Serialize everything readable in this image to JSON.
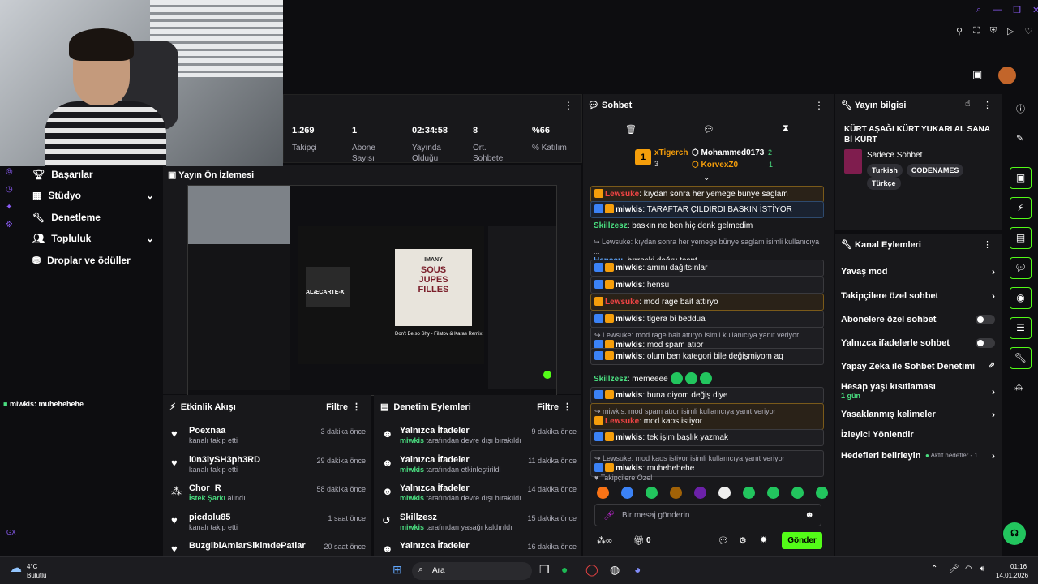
{
  "stats": [
    {
      "value": "1.269",
      "label": "Takipçi"
    },
    {
      "value": "1",
      "label": "Abone Sayısı"
    },
    {
      "value": "02:34:58",
      "label": "Yayında Olduğu"
    },
    {
      "value": "8",
      "label": "Ort. Sohbete"
    },
    {
      "value": "%66",
      "label": "% Katılım"
    }
  ],
  "nav": [
    {
      "label": "Başarılar",
      "chevron": false
    },
    {
      "label": "Stüdyo",
      "chevron": true
    },
    {
      "label": "Denetleme",
      "chevron": false
    },
    {
      "label": "Topluluk",
      "chevron": true
    },
    {
      "label": "Droplar ve ödüller",
      "chevron": false
    }
  ],
  "left_chat": {
    "user": "miwkis",
    "text": ": muhehehehe"
  },
  "preview": {
    "title": "Yayın Ön İzlemesi",
    "album_top": "IMANY",
    "album_mid": "SOUS",
    "album_mid2": "JUPES",
    "album_bot": "FILLES",
    "track": "Don't Be so Shy - Filatov & Karas Remix",
    "left_album": "ALÆCARTE-X"
  },
  "activity": {
    "title": "Etkinlik Akışı",
    "filter": "Filtre",
    "items": [
      {
        "name": "Poexnaa",
        "sub": "kanalı takip etti",
        "sub_green": "",
        "time": "3 dakika önce",
        "icon": "heart-icon"
      },
      {
        "name": "l0n3lySH3ph3RD",
        "sub": "kanalı takip etti",
        "sub_green": "",
        "time": "29 dakika önce",
        "icon": "heart-icon"
      },
      {
        "name": "Chor_R",
        "sub": "alındı",
        "sub_green": "İstek Şarkı",
        "time": "58 dakika önce",
        "icon": "points-icon"
      },
      {
        "name": "picdolu85",
        "sub": "kanalı takip etti",
        "sub_green": "",
        "time": "1 saat önce",
        "icon": "heart-icon"
      },
      {
        "name": "BuzgibiAmlarSikimdePatlar",
        "sub": "",
        "sub_green": "",
        "time": "20 saat önce",
        "icon": "heart-icon"
      }
    ]
  },
  "moderation": {
    "title": "Denetim Eylemleri",
    "filter": "Filtre",
    "items": [
      {
        "name": "Yalnızca İfadeler",
        "user": "miwkis",
        "sub": "tarafından devre dışı bırakıldı",
        "time": "9 dakika önce"
      },
      {
        "name": "Yalnızca İfadeler",
        "user": "miwkis",
        "sub": "tarafından etkinleştirildi",
        "time": "11 dakika önce"
      },
      {
        "name": "Yalnızca İfadeler",
        "user": "miwkis",
        "sub": "tarafından devre dışı bırakıldı",
        "time": "14 dakika önce"
      },
      {
        "name": "Skillzesz",
        "user": "miwkis",
        "sub": "tarafından yasağı kaldırıldı",
        "time": "15 dakika önce"
      },
      {
        "name": "Yalnızca İfadeler",
        "user": "",
        "sub": "",
        "time": "16 dakika önce"
      }
    ]
  },
  "chat": {
    "title": "Sohbet",
    "top_gifters": [
      {
        "rank": "1",
        "name": "xTigerch",
        "count": "3"
      },
      {
        "name": "Mohammed0173",
        "count": "2"
      },
      {
        "name": "KorvexZ0",
        "count": "1"
      }
    ],
    "messages": [
      {
        "reply": "",
        "user": "Lewsuke",
        "utype": "red",
        "text": ": kıydan sonra her yemege bünye saglam",
        "style": "redbox",
        "badges": 1
      },
      {
        "reply": "",
        "user": "miwkis",
        "utype": "blue",
        "text": ": TARAFTAR ÇILDIRDI BASKIN İSTİYOR",
        "style": "bluebox",
        "badges": 2
      },
      {
        "reply": "",
        "user": "Skillzesz",
        "utype": "green",
        "text": ": baskın ne ben hiç denk gelmedim",
        "style": "",
        "badges": 0
      },
      {
        "reply": "Lewsuke: kıydan sonra her yemege bünye saglam isimli kullanıcıya ...",
        "user": "Henssu",
        "utype": "cyan",
        "text": ": brrroski doğru tespt",
        "style": "",
        "badges": 0
      },
      {
        "reply": "",
        "user": "miwkis",
        "utype": "blue",
        "text": ": amını dağıtsınlar",
        "style": "box",
        "badges": 2
      },
      {
        "reply": "",
        "user": "miwkis",
        "utype": "blue",
        "text": ": hensu",
        "style": "box",
        "badges": 2
      },
      {
        "reply": "",
        "user": "Lewsuke",
        "utype": "red",
        "text": ": mod rage bait attıryo",
        "style": "redbox",
        "badges": 1
      },
      {
        "reply": "",
        "user": "miwkis",
        "utype": "blue",
        "text": ": tigera bi beddua",
        "style": "box",
        "badges": 2
      },
      {
        "reply": "Lewsuke: mod rage bait attıryo isimli kullanıcıya yanıt veriyor",
        "user": "miwkis",
        "utype": "blue",
        "text": ": mod spam atıor",
        "style": "box",
        "badges": 2
      },
      {
        "reply": "",
        "user": "miwkis",
        "utype": "blue",
        "text": ": olum ben kategori bile değişmiyom aq",
        "style": "box",
        "badges": 2
      },
      {
        "reply": "",
        "user": "Skillzesz",
        "utype": "green",
        "text": ": memeeee",
        "style": "",
        "badges": 0,
        "emotes": 3
      },
      {
        "reply": "",
        "user": "miwkis",
        "utype": "blue",
        "text": ": buna diyom değiş diye",
        "style": "box",
        "badges": 2
      },
      {
        "reply": "miwkis: mod spam atıor isimli kullanıcıya yanıt veriyor",
        "user": "Lewsuke",
        "utype": "red",
        "text": ": mod kaos istiyor",
        "style": "redbox",
        "badges": 1
      },
      {
        "reply": "",
        "user": "miwkis",
        "utype": "blue",
        "text": ": tek işim başlık yazmak",
        "style": "box",
        "badges": 2
      },
      {
        "reply": "Lewsuke: mod kaos istiyor isimli kullanıcıya yanıt veriyor",
        "user": "miwkis",
        "utype": "blue",
        "text": ": muhehehehe",
        "style": "box",
        "badges": 2
      }
    ],
    "followers_only_label": "Takipçilere Özel",
    "placeholder": "Bir mesaj gönderin",
    "points": "0",
    "send": "Gönder"
  },
  "stream_info": {
    "title": "Yayın bilgisi",
    "stream_title": "KÜRT AŞAĞI KÜRT YUKARI AL SANA Bİ KÜRT",
    "category": "Sadece Sohbet",
    "tags": [
      "Turkish",
      "CODENAMES",
      "Türkçe"
    ]
  },
  "channel_actions": {
    "title": "Kanal Eylemleri",
    "items": [
      {
        "label": "Yavaş mod",
        "control": "chevron",
        "sub": ""
      },
      {
        "label": "Takipçilere özel sohbet",
        "control": "chevron",
        "sub": ""
      },
      {
        "label": "Abonelere özel sohbet",
        "control": "toggle",
        "sub": ""
      },
      {
        "label": "Yalnızca ifadelerle sohbet",
        "control": "toggle",
        "sub": ""
      },
      {
        "label": "Yapay Zeka ile Sohbet Denetimi",
        "control": "external",
        "sub": ""
      },
      {
        "label": "Hesap yaşı kısıtlaması",
        "control": "chevron",
        "sub": "1 gün"
      },
      {
        "label": "Yasaklanmış kelimeler",
        "control": "chevron",
        "sub": ""
      },
      {
        "label": "İzleyici Yönlendir",
        "control": "none",
        "sub": ""
      },
      {
        "label": "Hedefleri belirleyin",
        "control": "chevron",
        "sub": "",
        "right_note": "Aktif hedefler - 1"
      }
    ]
  },
  "taskbar": {
    "weather_temp": "4°C",
    "weather_desc": "Bulutlu",
    "search": "Ara",
    "time": "01:16",
    "date": "14.01.2026"
  },
  "left_side": {
    "gx": "GX"
  },
  "colors": {
    "accent": "#53fc18",
    "purple": "#8b5cf6",
    "panel": "#18181b",
    "bg": "#0d0d10"
  }
}
